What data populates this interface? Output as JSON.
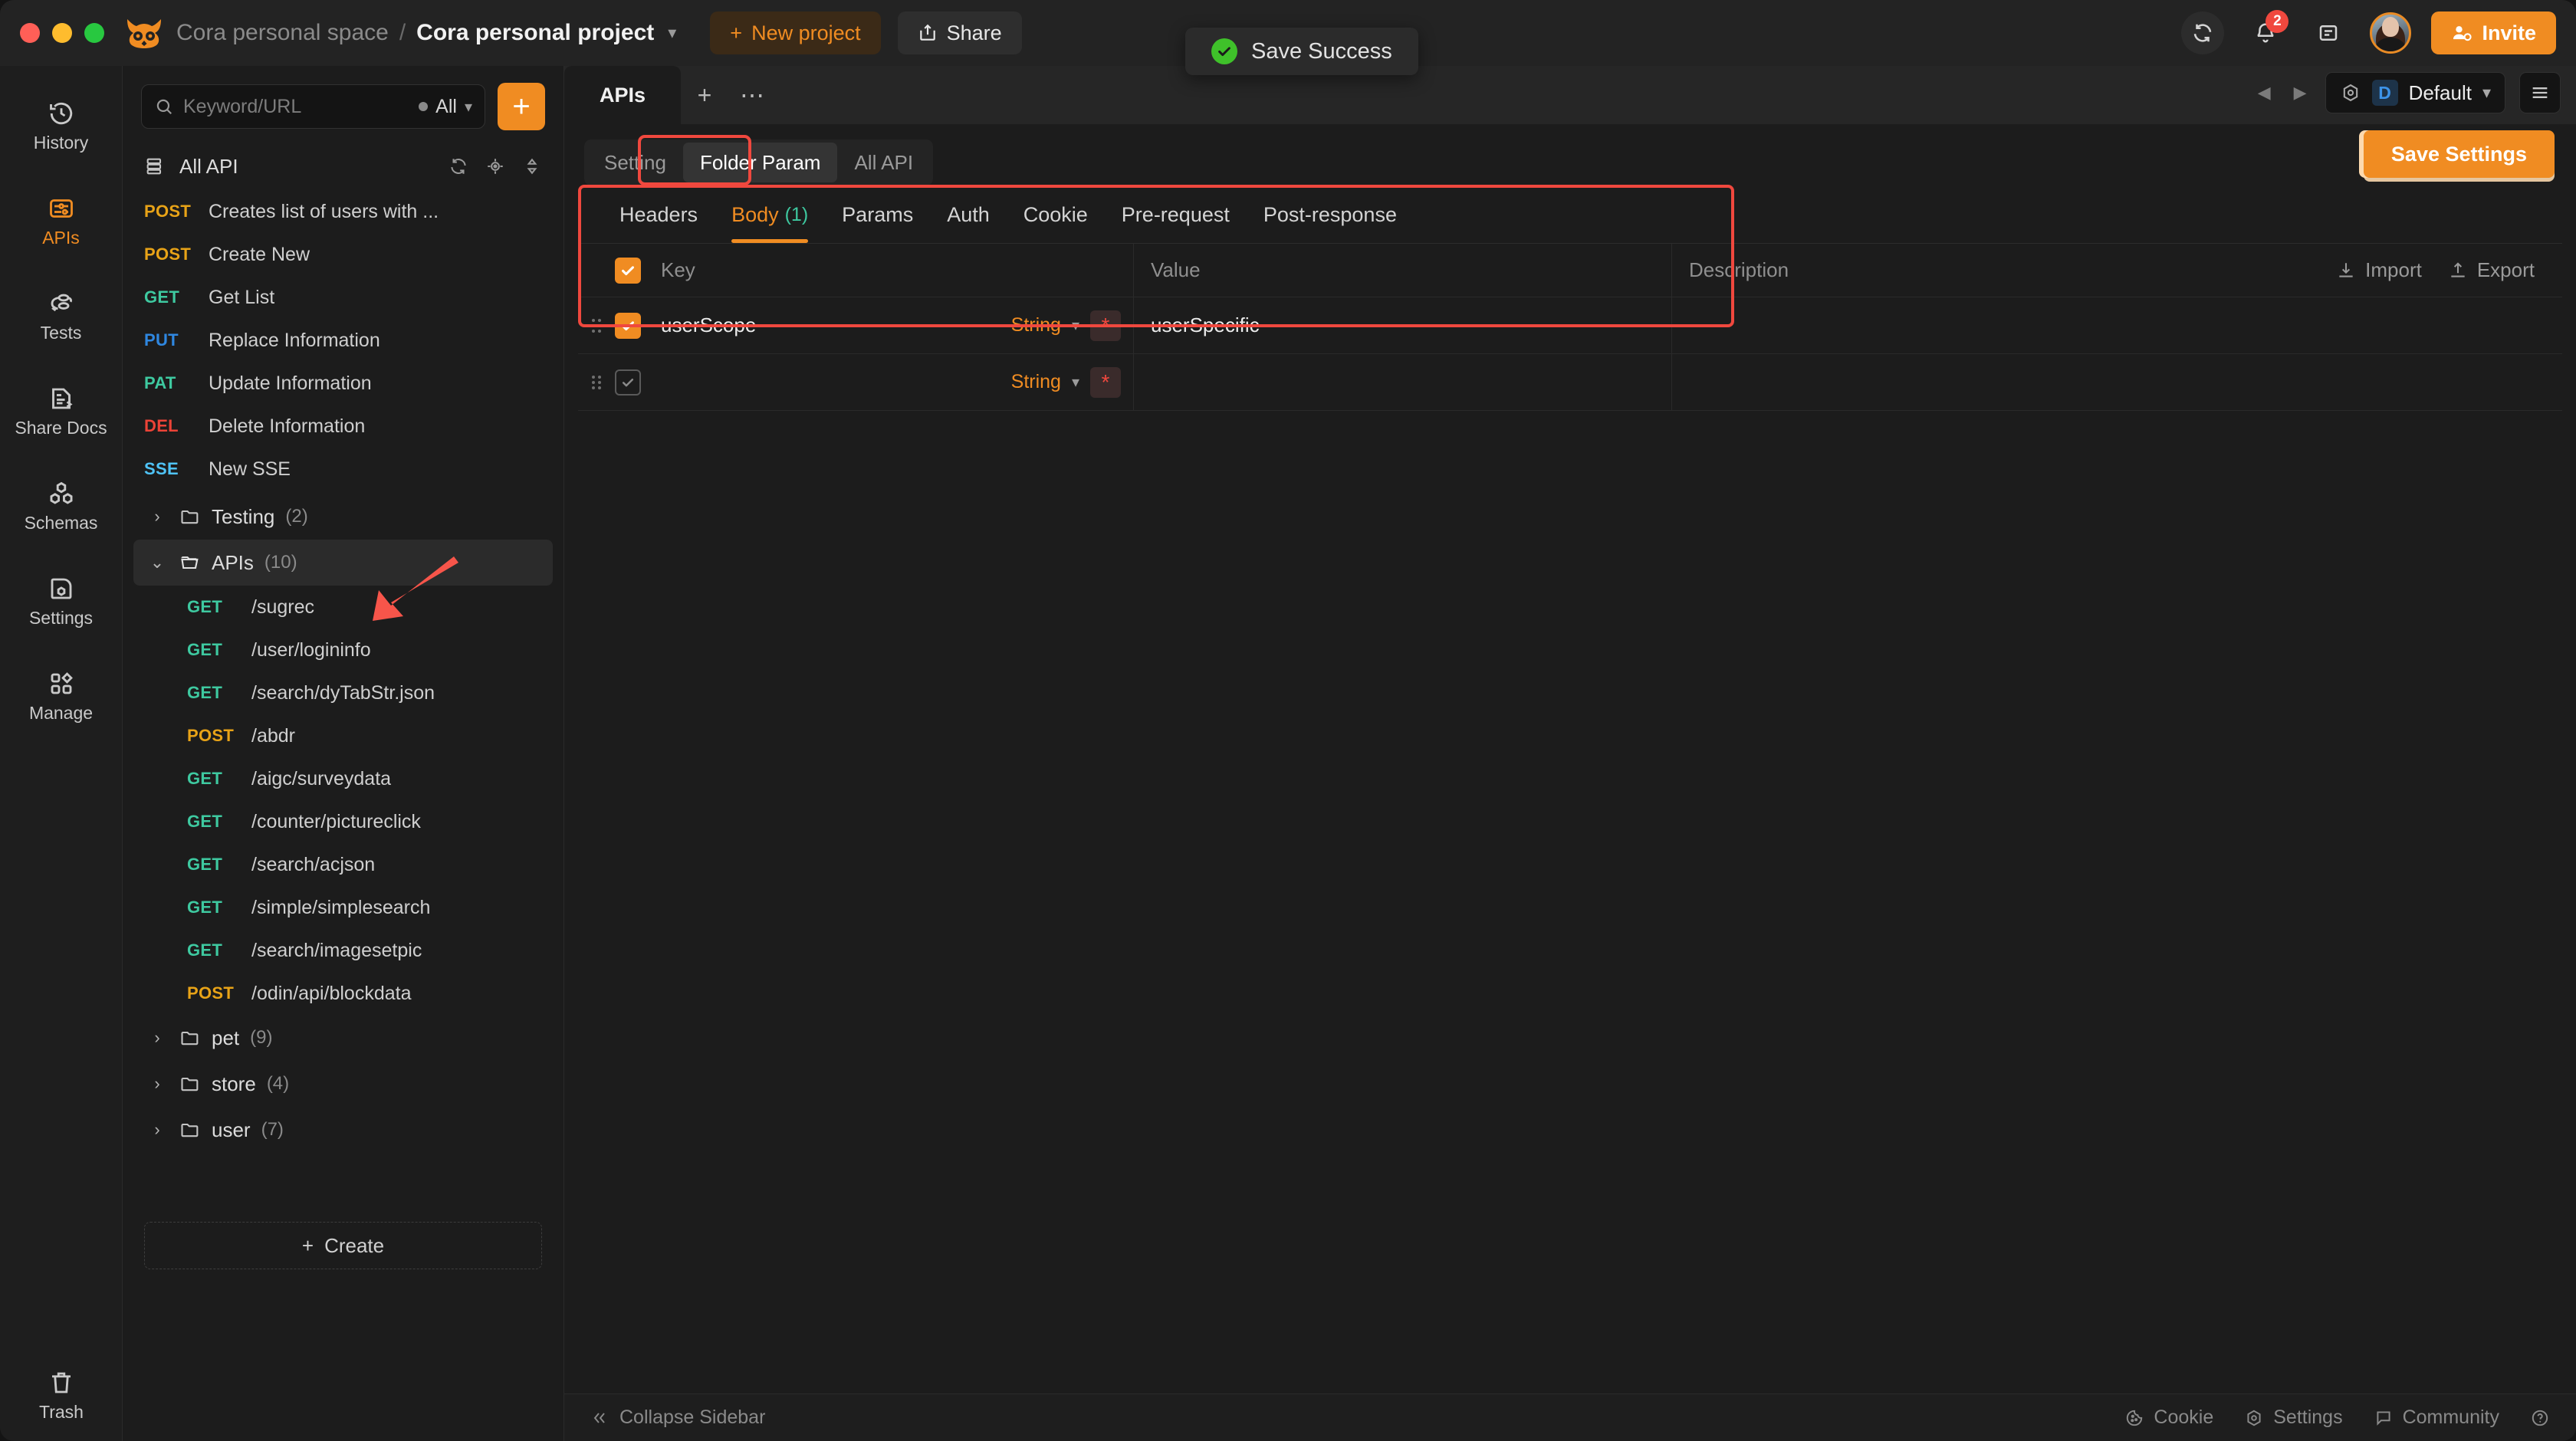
{
  "window": {
    "traffic_lights": [
      "close",
      "minimize",
      "maximize"
    ],
    "logo": "owl-logo"
  },
  "titlebar": {
    "space_name": "Cora personal space",
    "separator": "/",
    "project_name": "Cora personal project",
    "new_project_label": "New project",
    "share_label": "Share",
    "notification_count": "2",
    "invite_label": "Invite"
  },
  "toast": {
    "message": "Save Success"
  },
  "rail": {
    "items": [
      {
        "label": "History",
        "icon": "history-icon",
        "active": false
      },
      {
        "label": "APIs",
        "icon": "apis-icon",
        "active": true
      },
      {
        "label": "Tests",
        "icon": "tests-icon",
        "active": false
      },
      {
        "label": "Share Docs",
        "icon": "share-docs-icon",
        "active": false
      },
      {
        "label": "Schemas",
        "icon": "schemas-icon",
        "active": false
      },
      {
        "label": "Settings",
        "icon": "settings-icon",
        "active": false
      },
      {
        "label": "Manage",
        "icon": "manage-icon",
        "active": false
      }
    ],
    "trash_label": "Trash"
  },
  "sidebar": {
    "search": {
      "placeholder": "Keyword/URL",
      "filter_label": "All"
    },
    "add_button_label": "+",
    "all_api_label": "All API",
    "all_api_actions": [
      "refresh-icon",
      "locate-icon",
      "sort-icon"
    ],
    "apis": [
      {
        "method": "POST",
        "name": "Creates list of users with ..."
      },
      {
        "method": "POST",
        "name": "Create New"
      },
      {
        "method": "GET",
        "name": "Get List"
      },
      {
        "method": "PUT",
        "name": "Replace Information"
      },
      {
        "method": "PAT",
        "name": "Update Information"
      },
      {
        "method": "DEL",
        "name": "Delete Information"
      },
      {
        "method": "SSE",
        "name": "New SSE"
      }
    ],
    "folders": [
      {
        "name": "Testing",
        "count": "(2)",
        "expanded": false,
        "selected": false,
        "children": []
      },
      {
        "name": "APIs",
        "count": "(10)",
        "expanded": true,
        "selected": true,
        "children": [
          {
            "method": "GET",
            "name": "/sugrec"
          },
          {
            "method": "GET",
            "name": "/user/logininfo"
          },
          {
            "method": "GET",
            "name": "/search/dyTabStr.json"
          },
          {
            "method": "POST",
            "name": "/abdr"
          },
          {
            "method": "GET",
            "name": "/aigc/surveydata"
          },
          {
            "method": "GET",
            "name": "/counter/pictureclick"
          },
          {
            "method": "GET",
            "name": "/search/acjson"
          },
          {
            "method": "GET",
            "name": "/simple/simplesearch"
          },
          {
            "method": "GET",
            "name": "/search/imagesetpic"
          },
          {
            "method": "POST",
            "name": "/odin/api/blockdata"
          }
        ]
      },
      {
        "name": "pet",
        "count": "(9)",
        "expanded": false,
        "selected": false,
        "children": []
      },
      {
        "name": "store",
        "count": "(4)",
        "expanded": false,
        "selected": false,
        "children": []
      },
      {
        "name": "user",
        "count": "(7)",
        "expanded": false,
        "selected": false,
        "children": []
      }
    ],
    "create_label": "Create"
  },
  "main": {
    "doc_tab_label": "APIs",
    "env": {
      "badge": "D",
      "name": "Default"
    },
    "segments": [
      {
        "label": "Setting",
        "active": false
      },
      {
        "label": "Folder Param",
        "active": true
      },
      {
        "label": "All API",
        "active": false
      }
    ],
    "save_settings_label": "Save Settings",
    "param_tabs": [
      {
        "label": "Headers",
        "count": "",
        "active": false
      },
      {
        "label": "Body",
        "count": "(1)",
        "active": true
      },
      {
        "label": "Params",
        "count": "",
        "active": false
      },
      {
        "label": "Auth",
        "count": "",
        "active": false
      },
      {
        "label": "Cookie",
        "count": "",
        "active": false
      },
      {
        "label": "Pre-request",
        "count": "",
        "active": false
      },
      {
        "label": "Post-response",
        "count": "",
        "active": false
      }
    ],
    "table": {
      "columns": {
        "key": "Key",
        "value": "Value",
        "description": "Description"
      },
      "import_label": "Import",
      "export_label": "Export",
      "header_checked": true,
      "rows": [
        {
          "checked": true,
          "key": "userScope",
          "type": "String",
          "required": "*",
          "value": "userSpecific",
          "description": ""
        },
        {
          "checked": false,
          "key": "",
          "type": "String",
          "required": "*",
          "value": "",
          "description": ""
        }
      ]
    }
  },
  "bottombar": {
    "collapse_label": "Collapse Sidebar",
    "items": [
      {
        "label": "Cookie",
        "icon": "cookie-icon"
      },
      {
        "label": "Settings",
        "icon": "gear-icon"
      },
      {
        "label": "Community",
        "icon": "chat-icon"
      }
    ],
    "help_icon": "help-icon"
  },
  "colors": {
    "accent": "#f08c22",
    "annotation": "#f0483e",
    "success": "#3fc12a",
    "get": "#3ec9a0",
    "post": "#e8a317",
    "put": "#2f87e0",
    "del": "#ec4337",
    "sse": "#4fc3f7"
  }
}
